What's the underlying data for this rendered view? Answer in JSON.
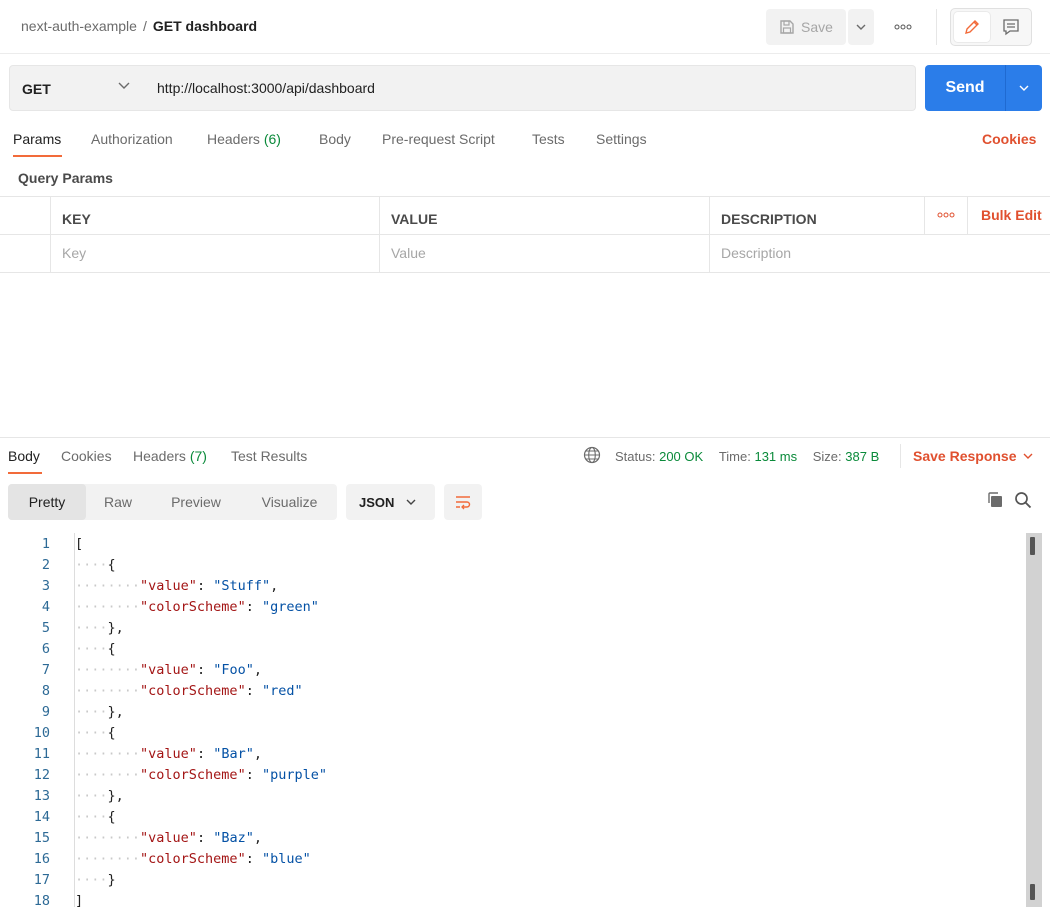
{
  "header": {
    "collection": "next-auth-example",
    "separator": "/",
    "request_title": "GET dashboard",
    "save_label": "Save"
  },
  "request": {
    "method": "GET",
    "url": "http://localhost:3000/api/dashboard",
    "send_label": "Send"
  },
  "request_tabs": [
    {
      "label": "Params",
      "count": ""
    },
    {
      "label": "Authorization",
      "count": ""
    },
    {
      "label": "Headers",
      "count": "(6)"
    },
    {
      "label": "Body",
      "count": ""
    },
    {
      "label": "Pre-request Script",
      "count": ""
    },
    {
      "label": "Tests",
      "count": ""
    },
    {
      "label": "Settings",
      "count": ""
    }
  ],
  "cookies_label": "Cookies",
  "query_params": {
    "title": "Query Params",
    "columns": [
      "KEY",
      "VALUE",
      "DESCRIPTION"
    ],
    "bulk_edit_label": "Bulk Edit",
    "placeholders": {
      "key": "Key",
      "value": "Value",
      "description": "Description"
    }
  },
  "response": {
    "tabs": [
      {
        "label": "Body",
        "count": ""
      },
      {
        "label": "Cookies",
        "count": ""
      },
      {
        "label": "Headers",
        "count": "(7)"
      },
      {
        "label": "Test Results",
        "count": ""
      }
    ],
    "status_label": "Status:",
    "status_value": "200 OK",
    "time_label": "Time:",
    "time_value": "131 ms",
    "size_label": "Size:",
    "size_value": "387 B",
    "save_response_label": "Save Response",
    "view_modes": [
      "Pretty",
      "Raw",
      "Preview",
      "Visualize"
    ],
    "active_view_mode": "Pretty",
    "format": "JSON"
  },
  "code_lines": [
    {
      "n": "1",
      "indent": 0,
      "parts": [
        {
          "t": "p",
          "v": "["
        }
      ]
    },
    {
      "n": "2",
      "indent": 1,
      "parts": [
        {
          "t": "p",
          "v": "{"
        }
      ]
    },
    {
      "n": "3",
      "indent": 2,
      "parts": [
        {
          "t": "k",
          "v": "\"value\""
        },
        {
          "t": "p",
          "v": ": "
        },
        {
          "t": "s",
          "v": "\"Stuff\""
        },
        {
          "t": "p",
          "v": ","
        }
      ]
    },
    {
      "n": "4",
      "indent": 2,
      "parts": [
        {
          "t": "k",
          "v": "\"colorScheme\""
        },
        {
          "t": "p",
          "v": ": "
        },
        {
          "t": "s",
          "v": "\"green\""
        }
      ]
    },
    {
      "n": "5",
      "indent": 1,
      "parts": [
        {
          "t": "p",
          "v": "},"
        }
      ]
    },
    {
      "n": "6",
      "indent": 1,
      "parts": [
        {
          "t": "p",
          "v": "{"
        }
      ]
    },
    {
      "n": "7",
      "indent": 2,
      "parts": [
        {
          "t": "k",
          "v": "\"value\""
        },
        {
          "t": "p",
          "v": ": "
        },
        {
          "t": "s",
          "v": "\"Foo\""
        },
        {
          "t": "p",
          "v": ","
        }
      ]
    },
    {
      "n": "8",
      "indent": 2,
      "parts": [
        {
          "t": "k",
          "v": "\"colorScheme\""
        },
        {
          "t": "p",
          "v": ": "
        },
        {
          "t": "s",
          "v": "\"red\""
        }
      ]
    },
    {
      "n": "9",
      "indent": 1,
      "parts": [
        {
          "t": "p",
          "v": "},"
        }
      ]
    },
    {
      "n": "10",
      "indent": 1,
      "parts": [
        {
          "t": "p",
          "v": "{"
        }
      ]
    },
    {
      "n": "11",
      "indent": 2,
      "parts": [
        {
          "t": "k",
          "v": "\"value\""
        },
        {
          "t": "p",
          "v": ": "
        },
        {
          "t": "s",
          "v": "\"Bar\""
        },
        {
          "t": "p",
          "v": ","
        }
      ]
    },
    {
      "n": "12",
      "indent": 2,
      "parts": [
        {
          "t": "k",
          "v": "\"colorScheme\""
        },
        {
          "t": "p",
          "v": ": "
        },
        {
          "t": "s",
          "v": "\"purple\""
        }
      ]
    },
    {
      "n": "13",
      "indent": 1,
      "parts": [
        {
          "t": "p",
          "v": "},"
        }
      ]
    },
    {
      "n": "14",
      "indent": 1,
      "parts": [
        {
          "t": "p",
          "v": "{"
        }
      ]
    },
    {
      "n": "15",
      "indent": 2,
      "parts": [
        {
          "t": "k",
          "v": "\"value\""
        },
        {
          "t": "p",
          "v": ": "
        },
        {
          "t": "s",
          "v": "\"Baz\""
        },
        {
          "t": "p",
          "v": ","
        }
      ]
    },
    {
      "n": "16",
      "indent": 2,
      "parts": [
        {
          "t": "k",
          "v": "\"colorScheme\""
        },
        {
          "t": "p",
          "v": ": "
        },
        {
          "t": "s",
          "v": "\"blue\""
        }
      ]
    },
    {
      "n": "17",
      "indent": 1,
      "parts": [
        {
          "t": "p",
          "v": "}"
        }
      ]
    },
    {
      "n": "18",
      "indent": 0,
      "parts": [
        {
          "t": "p",
          "v": "]"
        }
      ]
    }
  ],
  "colors": {
    "accent": "#f26b3a",
    "link": "#e0502f",
    "send": "#2b7de9",
    "success": "#0a8a3a",
    "json_key": "#a31515",
    "json_string": "#0451a5"
  },
  "icons": [
    "save-icon",
    "chevron-down-icon",
    "more-horizontal-icon",
    "pencil-icon",
    "comment-icon",
    "globe-icon",
    "wrap-lines-icon",
    "copy-icon",
    "search-icon"
  ]
}
